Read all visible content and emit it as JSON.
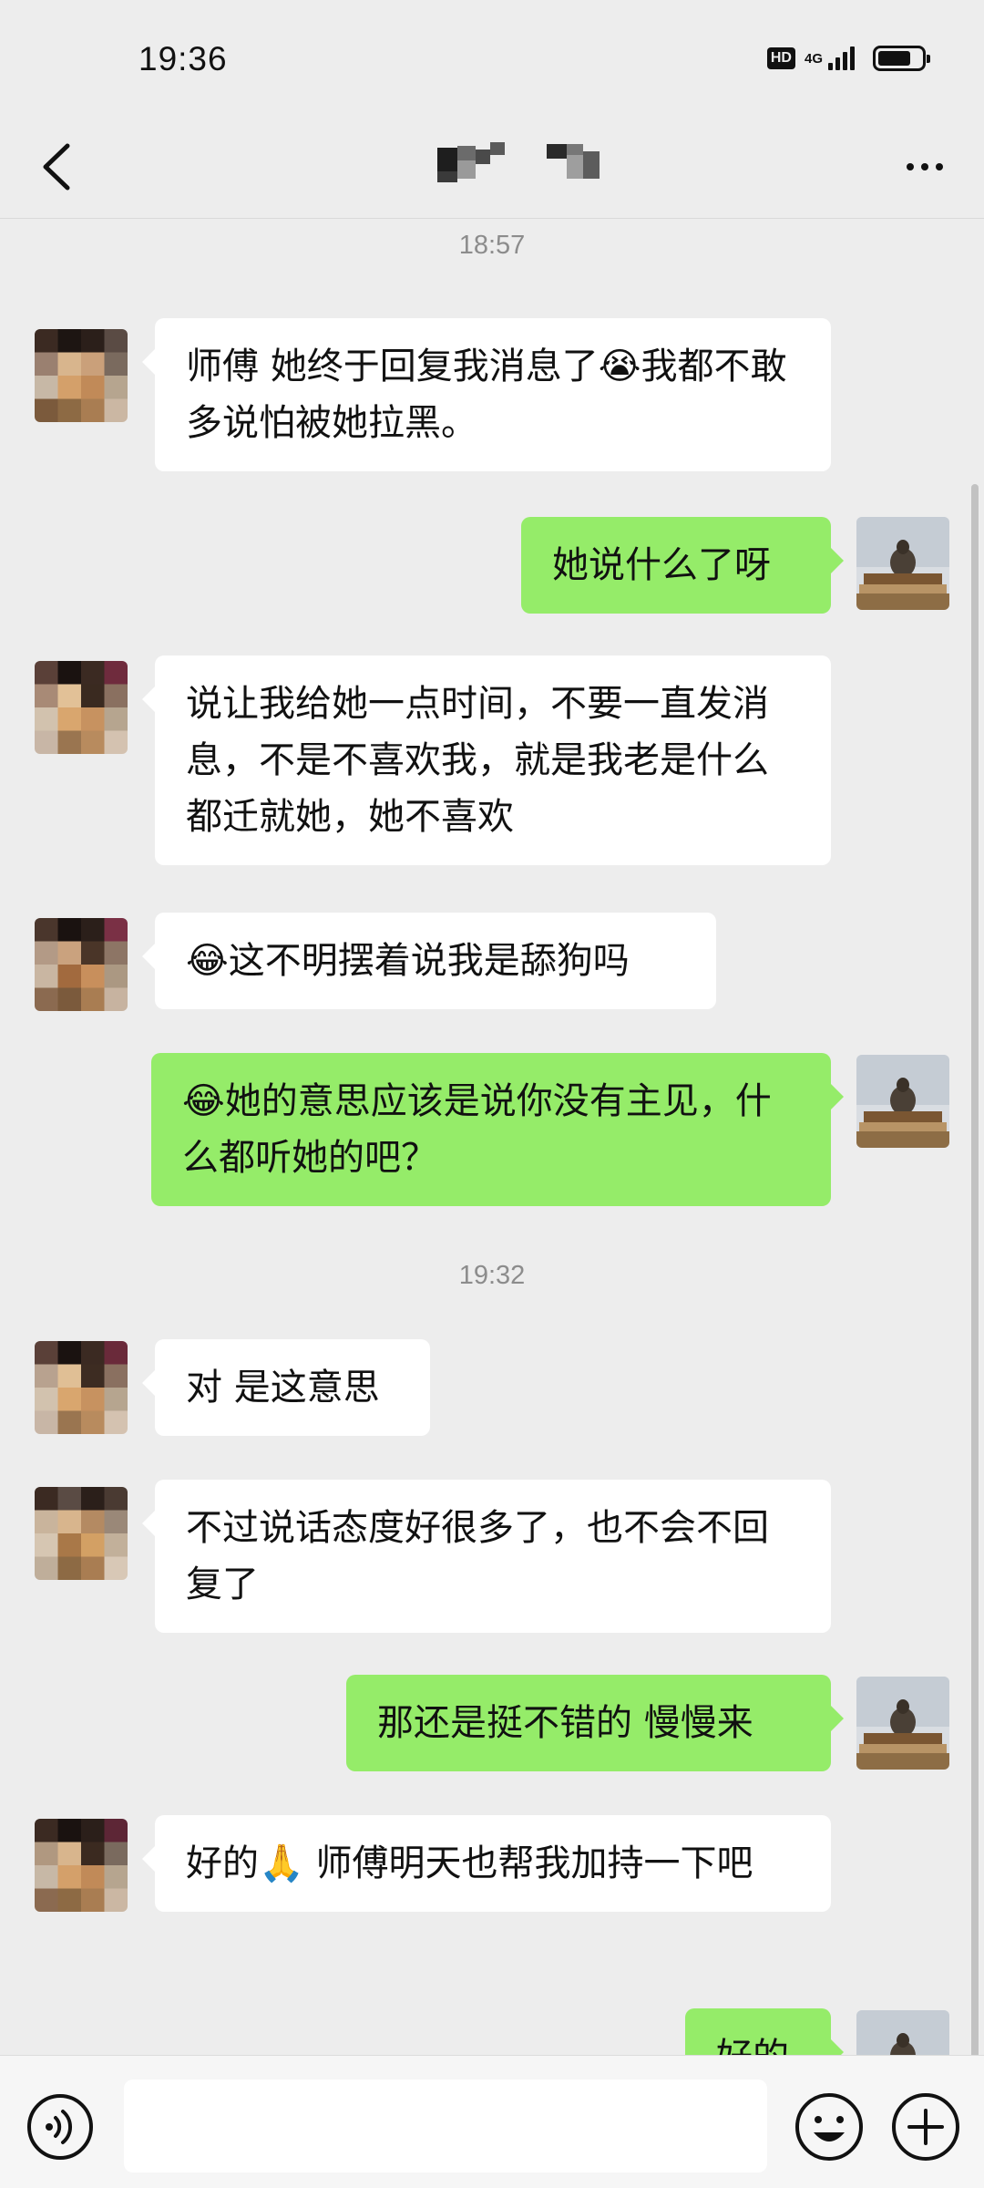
{
  "status_bar": {
    "time": "19:36",
    "hd_label": "HD",
    "network_label": "4G",
    "battery_level": 0.75
  },
  "header": {
    "back_icon": "chevron-left-icon",
    "title": "",
    "title_redacted": true,
    "more_icon": "more-horizontal-icon"
  },
  "chat": {
    "timestamps": [
      "18:57",
      "19:32"
    ],
    "messages": [
      {
        "side": "left",
        "text": "师傅 她终于回复我消息了😭我都不敢多说怕被她拉黑。"
      },
      {
        "side": "right",
        "text": "她说什么了呀"
      },
      {
        "side": "left",
        "text": "说让我给她一点时间，不要一直发消息，不是不喜欢我，就是我老是什么都迁就她，她不喜欢"
      },
      {
        "side": "left",
        "text": "😂这不明摆着说我是舔狗吗"
      },
      {
        "side": "right",
        "text": "😂她的意思应该是说你没有主见，什么都听她的吧？"
      },
      {
        "side": "left",
        "text": "对 是这意思"
      },
      {
        "side": "left",
        "text": "不过说话态度好很多了，也不会不回复了"
      },
      {
        "side": "right",
        "text": "那还是挺不错的 慢慢来"
      },
      {
        "side": "left",
        "text": "好的🙏 师傅明天也帮我加持一下吧"
      },
      {
        "side": "right",
        "text": "好的"
      }
    ]
  },
  "input_bar": {
    "voice_icon": "voice-input-icon",
    "input_value": "",
    "emoji_icon": "emoji-icon",
    "plus_icon": "plus-circle-icon"
  },
  "colors": {
    "background": "#ededed",
    "bubble_mine": "#95ec69",
    "bubble_theirs": "#ffffff",
    "timestamp": "#8c8c8c"
  }
}
